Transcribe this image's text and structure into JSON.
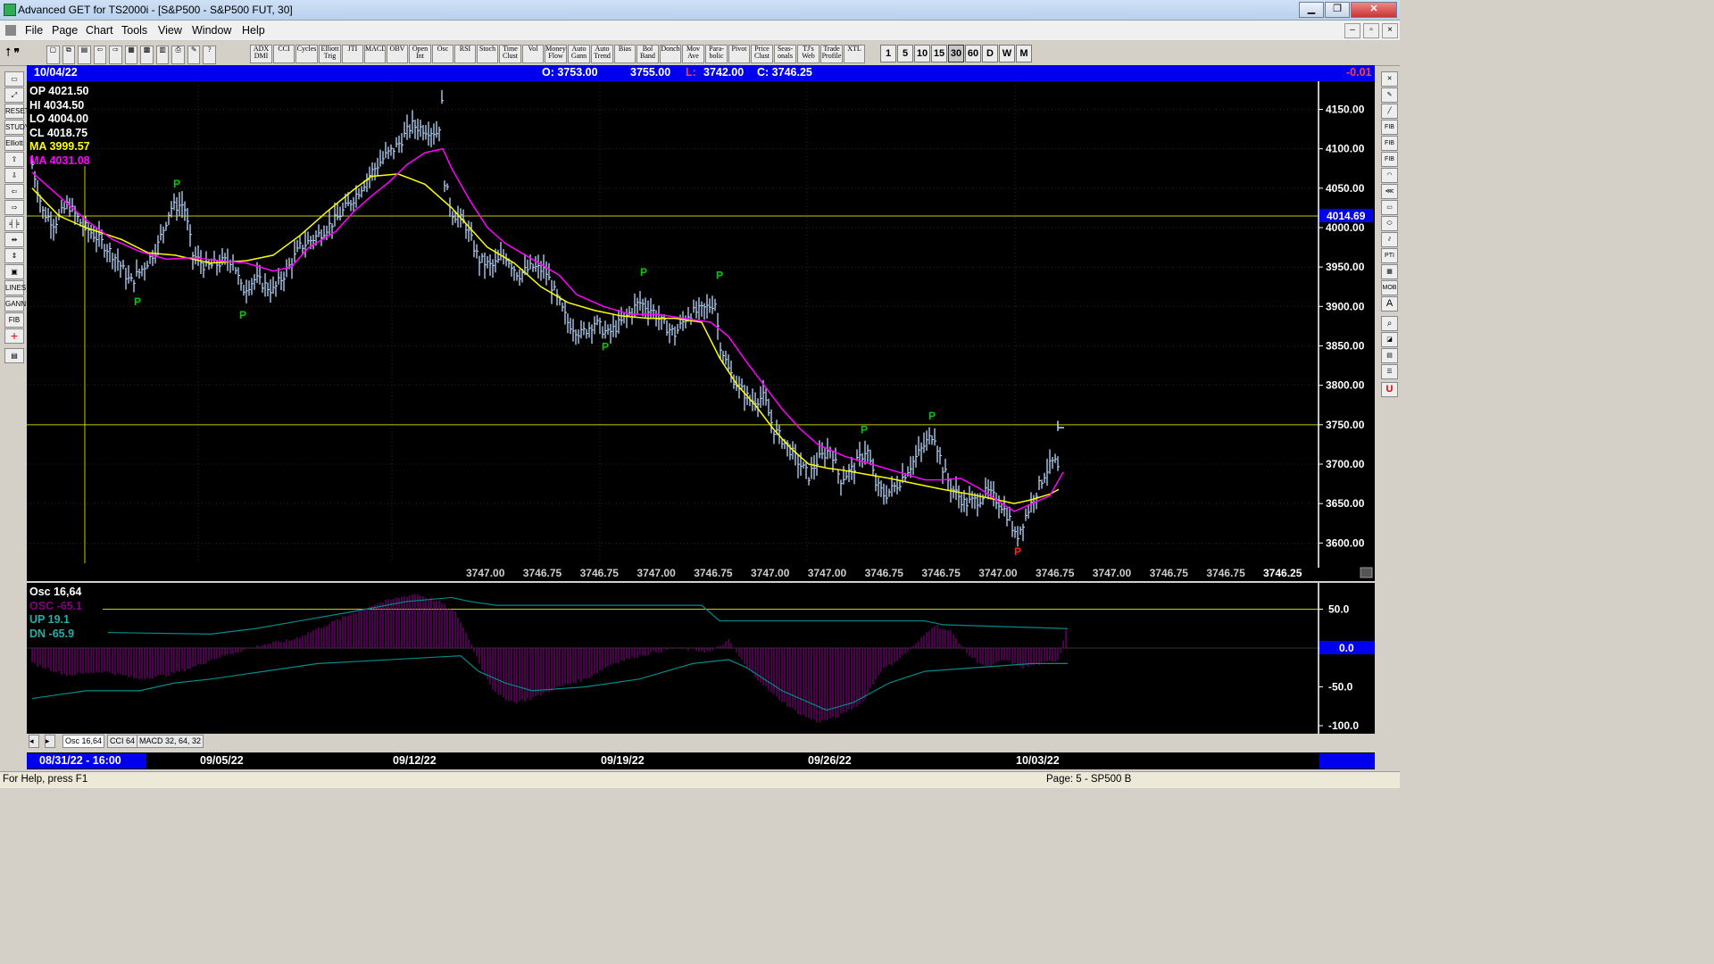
{
  "window": {
    "title": "Advanced GET for TS2000i - [S&P500 - S&P500 FUT, 30]",
    "minimize": "▁",
    "restore": "❐",
    "close": "✕"
  },
  "menu": [
    "File",
    "Page",
    "Chart",
    "Tools",
    "View",
    "Window",
    "Help"
  ],
  "toolbar": {
    "studies": [
      "ADX DMI",
      "CCI",
      "Cycles",
      "Elliott Trig",
      "JTI",
      "MACD",
      "OBV",
      "Open Int",
      "Osc",
      "RSI",
      "Stoch",
      "Time Clust",
      "Vol",
      "Money Flow",
      "Auto Gann",
      "Auto Trend",
      "Bias",
      "Bol Band",
      "Donch",
      "Mov Ave",
      "Para-bolic",
      "Pivot",
      "Price Clust",
      "Seas-onals",
      "TJ's Web",
      "Trade Profile",
      "XTL"
    ],
    "intervals": [
      "1",
      "5",
      "10",
      "15",
      "30",
      "60",
      "D",
      "W",
      "M"
    ],
    "active_interval": "30"
  },
  "header": {
    "date": "10/04/22",
    "open": "O: 3753.00",
    "high": "3755.00",
    "low_label": "L:",
    "low": "3742.00",
    "close": "C: 3746.25",
    "change": "-0.01"
  },
  "info": {
    "op": "OP  4021.50",
    "hi": "HI   4034.50",
    "lo": "LO  4004.00",
    "cl": "CL  4018.75",
    "ma1": "MA  3999.57",
    "ma2": "MA  4031.08"
  },
  "price_axis": {
    "ticks": [
      "4150.00",
      "4100.00",
      "4050.00",
      "4000.00",
      "3950.00",
      "3900.00",
      "3850.00",
      "3800.00",
      "3750.00",
      "3700.00",
      "3650.00",
      "3600.00"
    ],
    "highlight_level": "4014.69",
    "bottom_readout": [
      "3747.00",
      "3746.75",
      "3746.75",
      "3747.00",
      "3746.75",
      "3747.00",
      "3747.00",
      "3746.75",
      "3746.75",
      "3747.00",
      "3746.75",
      "3747.00",
      "3746.75",
      "3746.75"
    ],
    "last_price": "3746.25"
  },
  "pivot_label": "P",
  "osc": {
    "title": "Osc 16,64",
    "osc": "OSC -65.1",
    "up": "UP   19.1",
    "dn": "DN   -65.9",
    "axis": [
      "50.0",
      "0.0",
      "-50.0",
      "-100.0"
    ]
  },
  "tabs": [
    "Osc 16,64",
    "CCI 64",
    "MACD 32, 64, 32"
  ],
  "dates": {
    "cursor": "08/31/22 - 16:00",
    "labels": [
      "09/05/22",
      "09/12/22",
      "09/19/22",
      "09/26/22",
      "10/03/22"
    ]
  },
  "status": {
    "help": "For Help, press F1",
    "page": "Page: 5 - SP500 B"
  },
  "colors": {
    "up_wave": "#ffff00",
    "ma_fast": "#ffff00",
    "ma_slow": "#ff00ff",
    "bars": "#b8d8ff",
    "pivot_green": "#00cc00",
    "pivot_red": "#ff2020",
    "osc_fill": "#800080",
    "osc_lines": "#008b8b"
  },
  "chart_data": {
    "type": "line",
    "title": "S&P500 FUT, 30",
    "ylim": [
      3580,
      4180
    ],
    "close_path": [
      [
        0,
        4080
      ],
      [
        12,
        4020
      ],
      [
        25,
        4005
      ],
      [
        40,
        4030
      ],
      [
        55,
        4005
      ],
      [
        75,
        3985
      ],
      [
        95,
        3960
      ],
      [
        110,
        3930
      ],
      [
        125,
        3950
      ],
      [
        140,
        3975
      ],
      [
        155,
        4025
      ],
      [
        170,
        4030
      ],
      [
        180,
        3965
      ],
      [
        195,
        3950
      ],
      [
        210,
        3955
      ],
      [
        225,
        3960
      ],
      [
        235,
        3920
      ],
      [
        250,
        3935
      ],
      [
        270,
        3920
      ],
      [
        285,
        3945
      ],
      [
        300,
        3975
      ],
      [
        320,
        3990
      ],
      [
        340,
        4010
      ],
      [
        355,
        4030
      ],
      [
        365,
        4045
      ],
      [
        380,
        4070
      ],
      [
        395,
        4090
      ],
      [
        410,
        4105
      ],
      [
        425,
        4130
      ],
      [
        440,
        4125
      ],
      [
        455,
        4120
      ],
      [
        460,
        4165
      ],
      [
        462,
        4060
      ],
      [
        470,
        4020
      ],
      [
        485,
        4005
      ],
      [
        500,
        3960
      ],
      [
        515,
        3950
      ],
      [
        530,
        3965
      ],
      [
        545,
        3940
      ],
      [
        560,
        3950
      ],
      [
        575,
        3945
      ],
      [
        590,
        3905
      ],
      [
        600,
        3880
      ],
      [
        615,
        3865
      ],
      [
        630,
        3880
      ],
      [
        645,
        3865
      ],
      [
        660,
        3880
      ],
      [
        680,
        3905
      ],
      [
        695,
        3895
      ],
      [
        705,
        3880
      ],
      [
        720,
        3865
      ],
      [
        735,
        3890
      ],
      [
        750,
        3895
      ],
      [
        765,
        3905
      ],
      [
        770,
        3855
      ],
      [
        780,
        3820
      ],
      [
        790,
        3800
      ],
      [
        805,
        3780
      ],
      [
        820,
        3785
      ],
      [
        830,
        3745
      ],
      [
        845,
        3725
      ],
      [
        860,
        3700
      ],
      [
        870,
        3685
      ],
      [
        880,
        3705
      ],
      [
        895,
        3720
      ],
      [
        905,
        3680
      ],
      [
        920,
        3695
      ],
      [
        935,
        3720
      ],
      [
        945,
        3675
      ],
      [
        955,
        3660
      ],
      [
        970,
        3675
      ],
      [
        985,
        3700
      ],
      [
        1000,
        3725
      ],
      [
        1010,
        3740
      ],
      [
        1020,
        3695
      ],
      [
        1030,
        3670
      ],
      [
        1045,
        3650
      ],
      [
        1060,
        3655
      ],
      [
        1070,
        3665
      ],
      [
        1085,
        3650
      ],
      [
        1095,
        3630
      ],
      [
        1102,
        3605
      ],
      [
        1115,
        3640
      ],
      [
        1125,
        3665
      ],
      [
        1135,
        3690
      ],
      [
        1145,
        3705
      ],
      [
        1150,
        3690
      ]
    ],
    "ma_fast": [
      [
        0,
        4050
      ],
      [
        30,
        4015
      ],
      [
        60,
        4000
      ],
      [
        100,
        3985
      ],
      [
        130,
        3968
      ],
      [
        160,
        3965
      ],
      [
        200,
        3955
      ],
      [
        240,
        3958
      ],
      [
        270,
        3965
      ],
      [
        300,
        3990
      ],
      [
        330,
        4020
      ],
      [
        360,
        4048
      ],
      [
        380,
        4065
      ],
      [
        410,
        4068
      ],
      [
        440,
        4055
      ],
      [
        470,
        4025
      ],
      [
        490,
        4000
      ],
      [
        510,
        3975
      ],
      [
        540,
        3955
      ],
      [
        570,
        3925
      ],
      [
        600,
        3905
      ],
      [
        630,
        3895
      ],
      [
        660,
        3888
      ],
      [
        690,
        3885
      ],
      [
        720,
        3885
      ],
      [
        750,
        3880
      ],
      [
        770,
        3835
      ],
      [
        790,
        3800
      ],
      [
        810,
        3775
      ],
      [
        830,
        3745
      ],
      [
        850,
        3720
      ],
      [
        870,
        3700
      ],
      [
        890,
        3695
      ],
      [
        910,
        3692
      ],
      [
        930,
        3688
      ],
      [
        960,
        3682
      ],
      [
        990,
        3675
      ],
      [
        1020,
        3668
      ],
      [
        1050,
        3662
      ],
      [
        1080,
        3655
      ],
      [
        1100,
        3650
      ],
      [
        1120,
        3655
      ],
      [
        1140,
        3662
      ],
      [
        1150,
        3668
      ]
    ],
    "ma_slow": [
      [
        0,
        4070
      ],
      [
        30,
        4040
      ],
      [
        60,
        4010
      ],
      [
        90,
        3985
      ],
      [
        120,
        3970
      ],
      [
        150,
        3960
      ],
      [
        180,
        3962
      ],
      [
        210,
        3958
      ],
      [
        240,
        3955
      ],
      [
        270,
        3945
      ],
      [
        290,
        3950
      ],
      [
        310,
        3975
      ],
      [
        340,
        3995
      ],
      [
        360,
        4020
      ],
      [
        380,
        4040
      ],
      [
        400,
        4058
      ],
      [
        420,
        4080
      ],
      [
        440,
        4095
      ],
      [
        460,
        4100
      ],
      [
        470,
        4075
      ],
      [
        490,
        4035
      ],
      [
        510,
        4000
      ],
      [
        530,
        3980
      ],
      [
        560,
        3960
      ],
      [
        590,
        3940
      ],
      [
        610,
        3915
      ],
      [
        640,
        3900
      ],
      [
        670,
        3890
      ],
      [
        700,
        3890
      ],
      [
        730,
        3885
      ],
      [
        760,
        3880
      ],
      [
        780,
        3862
      ],
      [
        800,
        3830
      ],
      [
        820,
        3800
      ],
      [
        840,
        3770
      ],
      [
        860,
        3745
      ],
      [
        880,
        3725
      ],
      [
        910,
        3710
      ],
      [
        940,
        3700
      ],
      [
        970,
        3690
      ],
      [
        1000,
        3680
      ],
      [
        1020,
        3680
      ],
      [
        1040,
        3682
      ],
      [
        1060,
        3670
      ],
      [
        1080,
        3655
      ],
      [
        1100,
        3640
      ],
      [
        1120,
        3650
      ],
      [
        1140,
        3660
      ],
      [
        1155,
        3690
      ]
    ],
    "pivots": [
      {
        "x": 118,
        "y": 3915,
        "dir": "low"
      },
      {
        "x": 162,
        "y": 4044,
        "dir": "high"
      },
      {
        "x": 236,
        "y": 3898,
        "dir": "low"
      },
      {
        "x": 642,
        "y": 3858,
        "dir": "low"
      },
      {
        "x": 685,
        "y": 3932,
        "dir": "high"
      },
      {
        "x": 770,
        "y": 3928,
        "dir": "high"
      },
      {
        "x": 932,
        "y": 3732,
        "dir": "high"
      },
      {
        "x": 1008,
        "y": 3750,
        "dir": "high"
      },
      {
        "x": 1104,
        "y": 3598,
        "dir": "low"
      }
    ],
    "osc_hist": [
      [
        0,
        -20
      ],
      [
        40,
        -35
      ],
      [
        80,
        -30
      ],
      [
        120,
        -40
      ],
      [
        150,
        -35
      ],
      [
        180,
        -25
      ],
      [
        200,
        -15
      ],
      [
        230,
        -5
      ],
      [
        260,
        5
      ],
      [
        290,
        10
      ],
      [
        320,
        25
      ],
      [
        350,
        40
      ],
      [
        380,
        55
      ],
      [
        410,
        65
      ],
      [
        430,
        70
      ],
      [
        455,
        60
      ],
      [
        475,
        45
      ],
      [
        490,
        10
      ],
      [
        505,
        -30
      ],
      [
        520,
        -60
      ],
      [
        540,
        -70
      ],
      [
        560,
        -65
      ],
      [
        590,
        -50
      ],
      [
        620,
        -40
      ],
      [
        650,
        -20
      ],
      [
        680,
        -10
      ],
      [
        720,
        0
      ],
      [
        760,
        -5
      ],
      [
        780,
        10
      ],
      [
        800,
        -25
      ],
      [
        830,
        -60
      ],
      [
        860,
        -85
      ],
      [
        880,
        -95
      ],
      [
        900,
        -90
      ],
      [
        930,
        -70
      ],
      [
        950,
        -30
      ],
      [
        970,
        -15
      ],
      [
        990,
        5
      ],
      [
        1010,
        30
      ],
      [
        1030,
        20
      ],
      [
        1050,
        -10
      ],
      [
        1070,
        -25
      ],
      [
        1090,
        -15
      ],
      [
        1110,
        -25
      ],
      [
        1130,
        -20
      ],
      [
        1150,
        -15
      ],
      [
        1160,
        35
      ]
    ]
  }
}
